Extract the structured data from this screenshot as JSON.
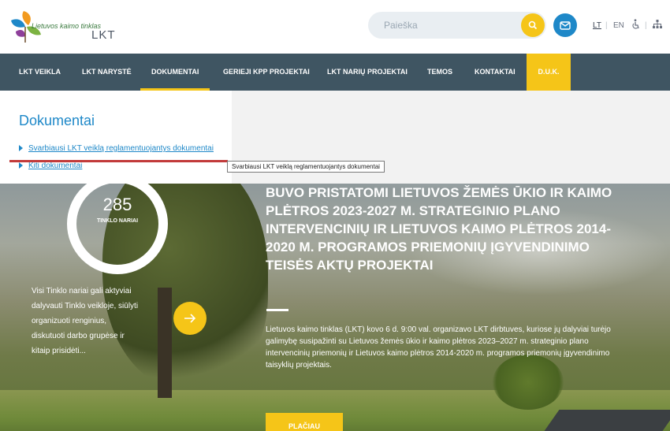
{
  "header": {
    "logo_line1": "Lietuvos kaimo tinklas",
    "logo_line2": "LKT",
    "search_placeholder": "Paieška",
    "lang_lt": "LT",
    "lang_en": "EN",
    "separator": "|"
  },
  "nav": {
    "items": [
      {
        "label": "LKT VEIKLA"
      },
      {
        "label": "LKT NARYSTĖ"
      },
      {
        "label": "DOKUMENTAI"
      },
      {
        "label": "GERIEJI KPP PROJEKTAI"
      },
      {
        "label": "LKT NARIŲ PROJEKTAI"
      },
      {
        "label": "TEMOS"
      },
      {
        "label": "KONTAKTAI"
      }
    ],
    "duk": "D.U.K."
  },
  "dropdown": {
    "title": "Dokumentai",
    "links": [
      "Svarbiausi LKT veiklą reglamentuojantys dokumentai",
      "Kiti dokumentai"
    ],
    "tooltip": "Svarbiausi LKT veiklą reglamentuojantys dokumentai"
  },
  "hero": {
    "members_count": "285",
    "members_label": "TINKLO NARIAI",
    "members_desc": "Visi Tinklo nariai gali aktyviai dalyvauti Tinklo veikloje, siūlyti organizuoti renginius, diskutuoti darbo grupėse ir kitaip prisidėti...",
    "title": "BUVO PRISTATOMI LIETUVOS ŽEMĖS ŪKIO IR KAIMO PLĖTROS 2023-2027 M. STRATEGINIO PLANO INTERVENCINIŲ IR LIETUVOS KAIMO PLĖTROS 2014-2020 M. PROGRAMOS PRIEMONIŲ ĮGYVENDINIMO TEISĖS AKTŲ PROJEKTAI",
    "text": "Lietuvos kaimo tinklas (LKT) kovo 6 d. 9:00 val. organizavo  LKT dirbtuves, kuriose jų dalyviai turėjo galimybę susipažinti su Lietuvos žemės ūkio ir kaimo plėtros 2023–2027 m. strateginio plano intervencinių priemonių  ir Lietuvos kaimo plėtros 2014-2020 m. programos priemonių įgyvendinimo taisyklių projektais.",
    "more_label": "PLAČIAU"
  }
}
